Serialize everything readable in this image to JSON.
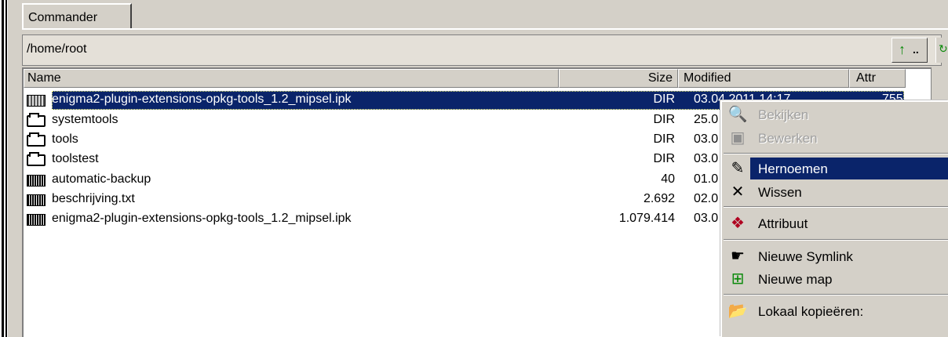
{
  "tabs": [
    {
      "label": "Commander",
      "active": true
    }
  ],
  "path": "/home/root",
  "buttons": {
    "up_icon": "green-up-arrow-icon",
    "up_label": ".."
  },
  "columns": {
    "name": "Name",
    "size": "Size",
    "modified": "Modified",
    "attr": "Attr"
  },
  "files": [
    {
      "name": "enigma2-plugin-extensions-opkg-tools_1.2_mipsel.ipk",
      "size": "DIR",
      "modified": "03.04.2011 14:17",
      "attr": "755",
      "icon": "package-folder-icon",
      "selected": true
    },
    {
      "name": "systemtools",
      "size": "DIR",
      "modified": "25.0",
      "attr": "",
      "icon": "folder-icon"
    },
    {
      "name": "tools",
      "size": "DIR",
      "modified": "03.0",
      "attr": "",
      "icon": "folder-icon"
    },
    {
      "name": "toolstest",
      "size": "DIR",
      "modified": "03.0",
      "attr": "",
      "icon": "folder-icon"
    },
    {
      "name": "automatic-backup",
      "size": "40",
      "modified": "01.0",
      "attr": "",
      "icon": "file-icon"
    },
    {
      "name": "beschrijving.txt",
      "size": "2.692",
      "modified": "02.0",
      "attr": "",
      "icon": "file-icon"
    },
    {
      "name": "enigma2-plugin-extensions-opkg-tools_1.2_mipsel.ipk",
      "size": "1.079.414",
      "modified": "03.0",
      "attr": "",
      "icon": "file-icon"
    }
  ],
  "context_menu": {
    "items": [
      {
        "label": "Bekijken",
        "icon": "view-icon",
        "enabled": false
      },
      {
        "label": "Bewerken",
        "icon": "edit-icon",
        "enabled": false
      },
      {
        "label": "Hernoemen",
        "icon": "rename-icon",
        "enabled": true,
        "highlighted": true
      },
      {
        "label": "Wissen",
        "icon": "delete-icon",
        "enabled": true
      },
      {
        "label": "Attribuut",
        "icon": "attribute-icon",
        "enabled": true
      },
      {
        "label": "Nieuwe Symlink",
        "icon": "symlink-icon",
        "enabled": true
      },
      {
        "label": "Nieuwe map",
        "icon": "new-folder-icon",
        "enabled": true
      },
      {
        "label": "Lokaal kopieëren:",
        "icon": "copy-local-icon",
        "enabled": true
      }
    ]
  },
  "colors": {
    "selection": "#0a246a",
    "face": "#d4d0c8",
    "accent_green": "#0a8a0a"
  }
}
